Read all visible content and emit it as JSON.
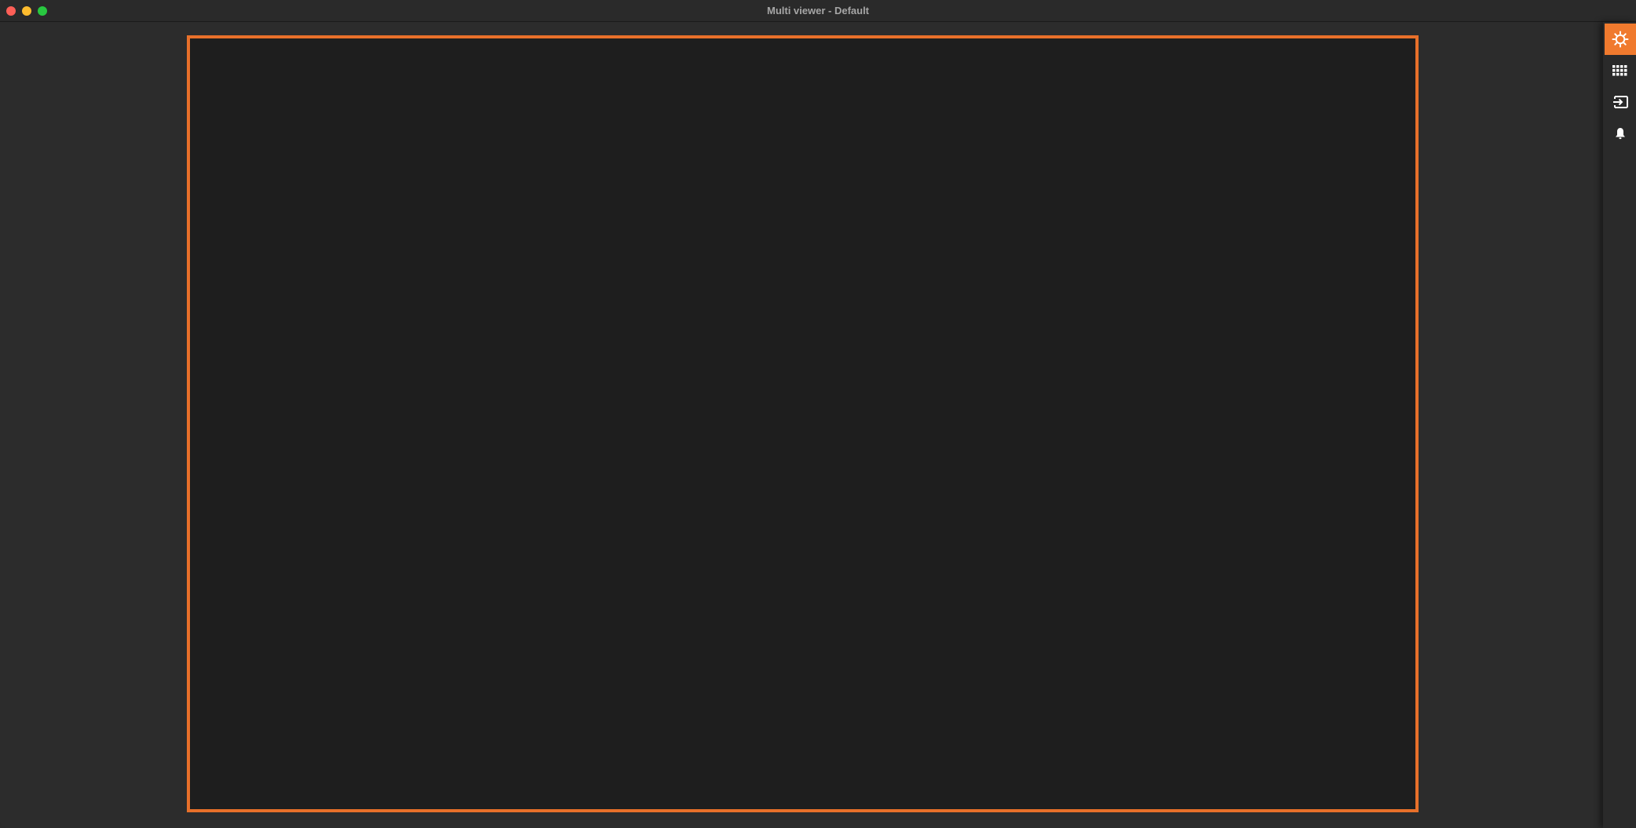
{
  "window": {
    "title": "Multi viewer - Default"
  },
  "colors": {
    "accent": "#e8702a",
    "active_tool_bg": "#f07a2e",
    "viewer_bg": "#1e1e1e",
    "window_bg": "#2c2c2c"
  },
  "toolbar": {
    "items": [
      {
        "icon": "gear-icon",
        "active": true
      },
      {
        "icon": "grid-icon",
        "active": false
      },
      {
        "icon": "input-icon",
        "active": false
      },
      {
        "icon": "bell-icon",
        "active": false
      }
    ]
  }
}
